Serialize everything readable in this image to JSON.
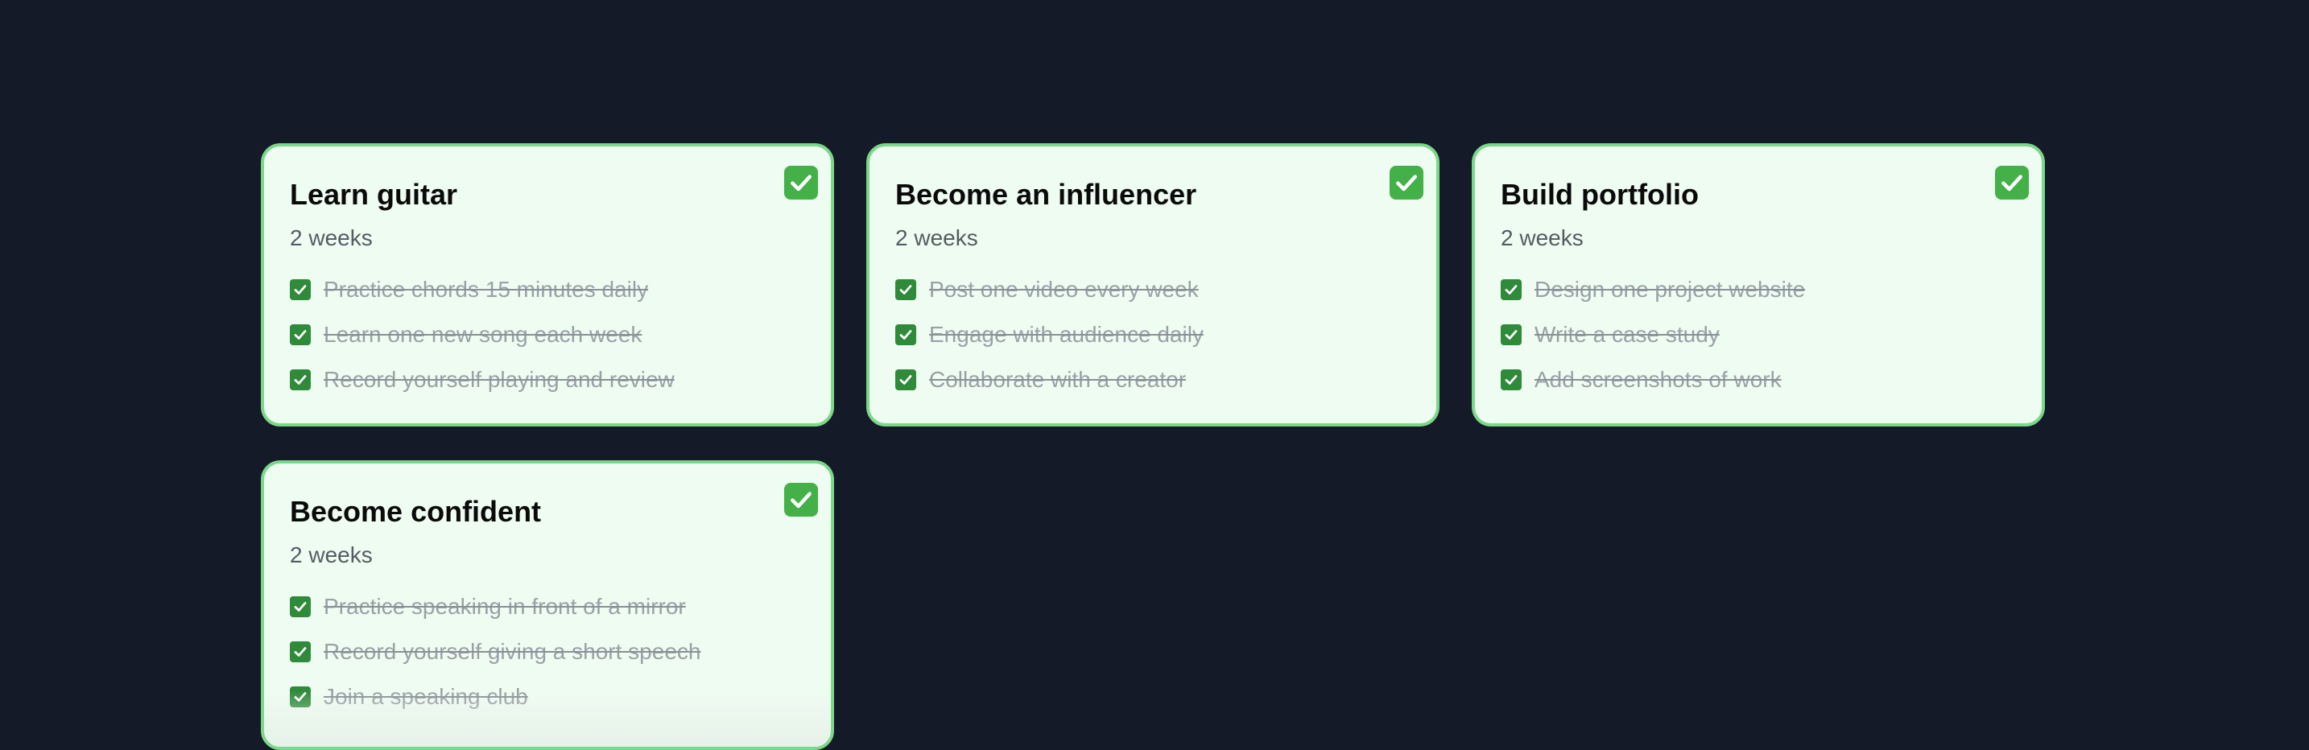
{
  "goals": [
    {
      "title": "Learn guitar",
      "duration": "2 weeks",
      "status_icon": "check-mark-button-icon",
      "tasks": [
        {
          "label": "Practice chords 15 minutes daily",
          "done": true
        },
        {
          "label": "Learn one new song each week",
          "done": true
        },
        {
          "label": "Record yourself playing and review",
          "done": true
        }
      ]
    },
    {
      "title": "Become an influencer",
      "duration": "2 weeks",
      "status_icon": "check-mark-button-icon",
      "tasks": [
        {
          "label": "Post one video every week",
          "done": true
        },
        {
          "label": "Engage with audience daily",
          "done": true
        },
        {
          "label": "Collaborate with a creator",
          "done": true
        }
      ]
    },
    {
      "title": "Build portfolio",
      "duration": "2 weeks",
      "status_icon": "check-mark-button-icon",
      "tasks": [
        {
          "label": "Design one project website",
          "done": true
        },
        {
          "label": "Write a case study",
          "done": true
        },
        {
          "label": "Add screenshots of work",
          "done": true
        }
      ]
    },
    {
      "title": "Become confident",
      "duration": "2 weeks",
      "status_icon": "check-mark-button-icon",
      "tasks": [
        {
          "label": "Practice speaking in front of a mirror",
          "done": true
        },
        {
          "label": "Record yourself giving a short speech",
          "done": true
        },
        {
          "label": "Join a speaking club",
          "done": true
        }
      ]
    }
  ],
  "colors": {
    "background": "#141a28",
    "card_background": "#effcf2",
    "card_border": "#7bd889",
    "badge": "#43b048",
    "checkbox": "#2f8a3a",
    "completed_text": "#9aa0a6"
  }
}
